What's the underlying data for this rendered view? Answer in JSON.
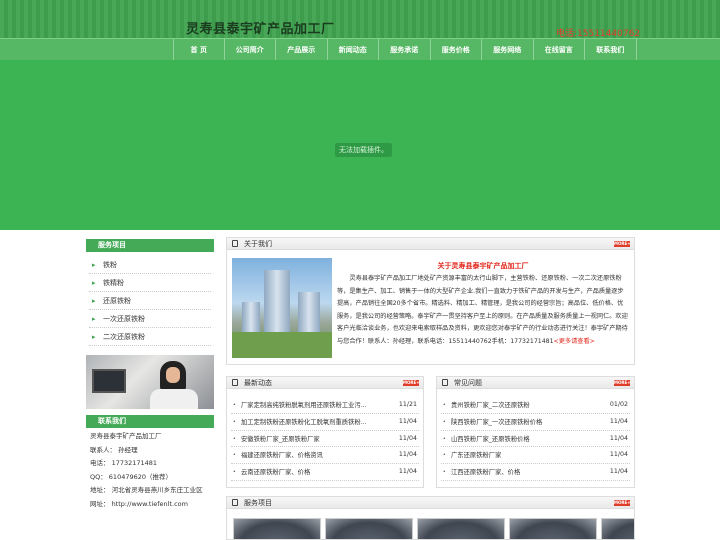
{
  "header": {
    "site_title": "灵寿县泰宇矿产品加工厂",
    "phone": "电话:15511440762"
  },
  "nav": [
    "首 页",
    "公司简介",
    "产品展示",
    "新闻动态",
    "服务承诺",
    "服务价格",
    "服务网络",
    "在线留言",
    "联系我们"
  ],
  "banner": {
    "plugin_message": "无法加载插件。"
  },
  "sidebar": {
    "services_title": "服务项目",
    "services": [
      "铁粉",
      "铁精粉",
      "还原铁粉",
      "一次还原铁粉",
      "二次还原铁粉"
    ],
    "contact_title": "联系我们",
    "contact_lines": [
      "灵寿县泰宇矿产品加工厂",
      "联系人：  孙经理",
      "电话：  17732171481",
      "QQ：  610479620（推荐）",
      "地址：  河北省灵寿县燕川乡东庄工业区",
      "网址：  http://www.tiefenlt.com"
    ]
  },
  "about": {
    "header": "关于我们",
    "more_badge": "MORE+",
    "title": "关于灵寿县泰宇矿产品加工厂",
    "text": "灵寿县泰宇矿产品加工厂地处矿产资源丰富的太行山脚下，主营铁粉、还原铁粉、一次二次还原铁粉等，是集生产、加工、销售于一体的大型矿产企业.我们一直致力于铁矿产品的开发与生产，产品质量逐步提高，产品销往全国20多个省市。精选料、精加工、精管理，是我公司的经营宗旨；高品位、低价格、优服务，是我公司的经营策略。泰宇矿产一贯坚持客户至上的原则。在产品质量及服务质量上一视同仁。欢迎客户光临洽谈业务，也欢迎来电索取样品及资料，更欢迎您对泰宇矿产的行业动态进行关注！泰宇矿产期待与您合作！联系人：孙经理，联系电话：15511440762手机：17732171481",
    "more_link": "<更多请查看>"
  },
  "news": {
    "header": "最新动态",
    "more_badge": "MORE+",
    "items": [
      {
        "title": "厂家定制高纯铁粉脱氧剂用还原铁粉工业污...",
        "date": "11/21"
      },
      {
        "title": "加工定制铁粉还原铁粉化工脱氧剂重质铁粉...",
        "date": "11/04"
      },
      {
        "title": "安徽铁粉厂家_还原铁粉厂家",
        "date": "11/04"
      },
      {
        "title": "福建还原铁粉厂家、价格资讯",
        "date": "11/04"
      },
      {
        "title": "云南还原铁粉厂家、价格",
        "date": "11/04"
      }
    ]
  },
  "faq": {
    "header": "常见问题",
    "more_badge": "MORE+",
    "items": [
      {
        "title": "贵州铁粉厂家_二次还原铁粉",
        "date": "01/02"
      },
      {
        "title": "陕西铁粉厂家_一次还原铁粉价格",
        "date": "11/04"
      },
      {
        "title": "山西铁粉厂家_还原铁粉价格",
        "date": "11/04"
      },
      {
        "title": "广东还原铁粉厂家",
        "date": "11/04"
      },
      {
        "title": "江西还原铁粉厂家、价格",
        "date": "11/04"
      }
    ]
  },
  "products": {
    "header": "服务项目",
    "more_badge": "MORE+"
  },
  "colors": {
    "header_green": "#3fa24f",
    "nav_green": "#56b864",
    "banner_green": "#3db454",
    "phone_red": "#e33b2c",
    "accent_red": "#e1261c"
  }
}
